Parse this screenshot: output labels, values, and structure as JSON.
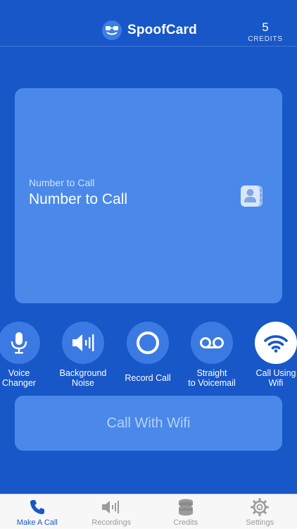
{
  "header": {
    "brand_name": "SpoofCard",
    "credits_count": "5",
    "credits_label": "CREDITS"
  },
  "number_card": {
    "label_small": "Number to Call",
    "label_large": "Number to Call",
    "contacts_icon": "contacts-icon"
  },
  "options": [
    {
      "label": "Voice\nChanger",
      "icon": "microphone-icon",
      "selected": false
    },
    {
      "label": "Background\nNoise",
      "icon": "speaker-icon",
      "selected": false
    },
    {
      "label": "Record Call",
      "icon": "record-icon",
      "selected": false
    },
    {
      "label": "Straight\nto Voicemail",
      "icon": "voicemail-icon",
      "selected": false
    },
    {
      "label": "Call Using\nWifi",
      "icon": "wifi-icon",
      "selected": true
    }
  ],
  "call_button": {
    "label": "Call With Wifi"
  },
  "tabbar": {
    "tabs": [
      {
        "label": "Make A Call",
        "icon": "phone-icon",
        "active": true
      },
      {
        "label": "Recordings",
        "icon": "speaker-icon",
        "active": false
      },
      {
        "label": "Credits",
        "icon": "coins-icon",
        "active": false
      },
      {
        "label": "Settings",
        "icon": "gear-icon",
        "active": false
      }
    ]
  },
  "colors": {
    "background": "#1857c8",
    "card": "#4a89ea",
    "option_circle": "#3c7ae3",
    "option_active": "#ffffff",
    "tab_active": "#1857c8",
    "tab_inactive": "#9b9b9b"
  }
}
